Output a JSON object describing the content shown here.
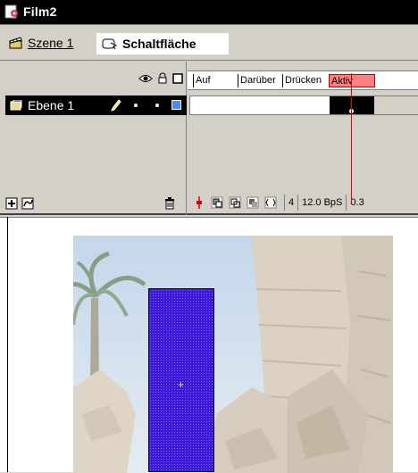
{
  "window": {
    "title": "Film2",
    "icon": "flash-document-icon"
  },
  "breadcrumb": {
    "scene_label": "Szene 1",
    "scene_icon": "scene-clapper-icon",
    "symbol_label": "Schaltfläche",
    "symbol_icon": "button-symbol-icon"
  },
  "timeline": {
    "header_icons": [
      "eye-icon",
      "lock-icon",
      "outline-square-icon"
    ],
    "layers": [
      {
        "name": "Ebene 1",
        "icon": "layer-icon",
        "edit_icon": "pencil-icon",
        "color": "#4a8cff"
      }
    ],
    "frame_labels": [
      "Auf",
      "Darüber",
      "Drücken",
      "Aktiv"
    ],
    "active_frame": "Aktiv",
    "footer": {
      "add_layer_icon": "add-layer-icon",
      "add_guide_icon": "add-guide-layer-icon",
      "delete_icon": "trash-icon",
      "current_frame": "4",
      "frame_rate": "12.0 BpS",
      "elapsed": "0.3"
    }
  },
  "colors": {
    "titlebar_bg": "#000000",
    "active_frame_bg": "#ff8080",
    "playhead": "#e00000",
    "button_fill": "#3b17d8",
    "layer_color": "#4a8cff"
  }
}
